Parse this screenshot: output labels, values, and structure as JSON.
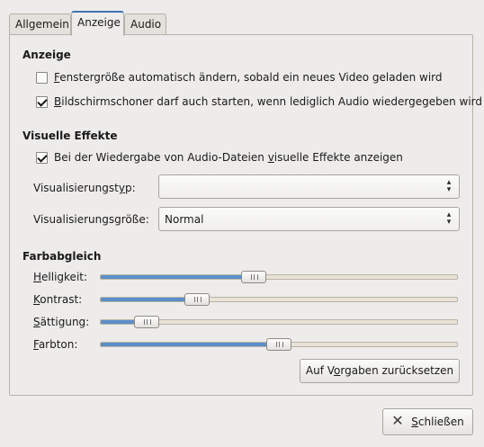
{
  "tabs": [
    {
      "label": "Allgemein"
    },
    {
      "label": "Anzeige"
    },
    {
      "label": "Audio"
    }
  ],
  "anzeige": {
    "title": "Anzeige",
    "option1": {
      "u": "F",
      "rest": "enstergröße automatisch ändern, sobald ein neues Video geladen wird",
      "checked": false
    },
    "option2": {
      "u": "B",
      "rest": "ildschirmschoner darf auch starten, wenn lediglich Audio wiedergegeben wird",
      "checked": true
    }
  },
  "effekte": {
    "title": "Visuelle Effekte",
    "option": {
      "pre": "Bei der Wiedergabe von Audio-Dateien ",
      "u": "v",
      "post": "isuelle Effekte anzeigen",
      "checked": true
    },
    "typ_label_pre": "Visualisierungst",
    "typ_label_u": "y",
    "typ_label_post": "p:",
    "typ_value": "",
    "groesse_label": "Visualisierungsgröße:",
    "groesse_value": "Normal"
  },
  "farbabgleich": {
    "title": "Farbabgleich",
    "sliders": [
      {
        "u": "H",
        "rest": "elligkeit:",
        "value": 0.43
      },
      {
        "u": "K",
        "rest": "ontrast:",
        "value": 0.27
      },
      {
        "u": "S",
        "rest": "ättigung:",
        "value": 0.13
      },
      {
        "u": "F",
        "rest": "arbton:",
        "value": 0.5
      }
    ],
    "reset_pre": "Auf V",
    "reset_u": "o",
    "reset_post": "rgaben zurücksetzen"
  },
  "close_button": {
    "pre": "",
    "u": "S",
    "post": "chließen"
  },
  "colors": {
    "accent": "#3f74b2",
    "slider_fill": "#5a8fcb",
    "background": "#edeceb"
  },
  "icons": {
    "close": "close-icon"
  }
}
